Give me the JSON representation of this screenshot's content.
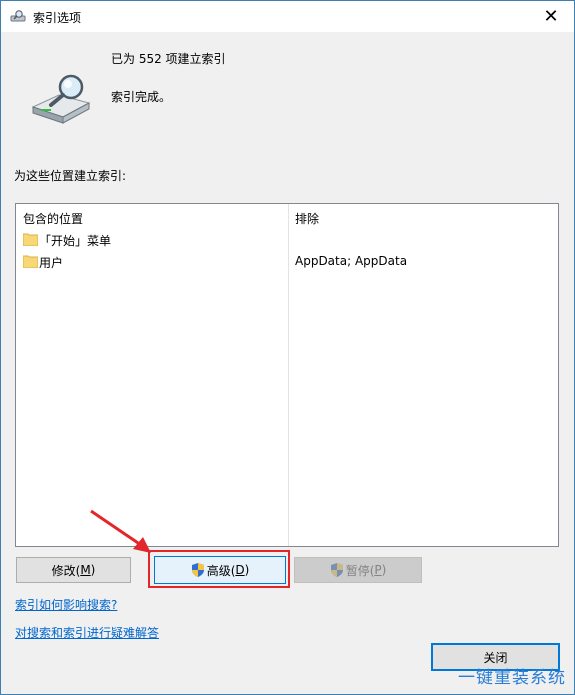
{
  "window": {
    "title": "索引选项"
  },
  "status": {
    "count_line": "已为 552 项建立索引",
    "state_line": "索引完成。"
  },
  "section": {
    "label": "为这些位置建立索引:"
  },
  "list": {
    "headers": {
      "location": "包含的位置",
      "exclude": "排除"
    },
    "rows": [
      {
        "location": "「开始」菜单",
        "exclude": ""
      },
      {
        "location": "用户",
        "exclude": "AppData; AppData"
      }
    ]
  },
  "buttons": {
    "modify": {
      "text": "修改(",
      "key": "M",
      "tail": ")"
    },
    "advanced": {
      "text": "高级(",
      "key": "D",
      "tail": ")"
    },
    "pause": {
      "text": "暂停(",
      "key": "P",
      "tail": ")"
    },
    "close": "关闭"
  },
  "links": {
    "how_affects": "索引如何影响搜索?",
    "troubleshoot": "对搜索和索引进行疑难解答"
  },
  "watermark": "一键重装系统",
  "colors": {
    "accent": "#0078d7",
    "link": "#0066cc",
    "highlight": "#e3262c"
  },
  "icons": [
    "indexing-icon",
    "magnifier-drive-icon",
    "folder-icon",
    "shield-icon",
    "close-icon",
    "arrow-annotation-icon"
  ]
}
